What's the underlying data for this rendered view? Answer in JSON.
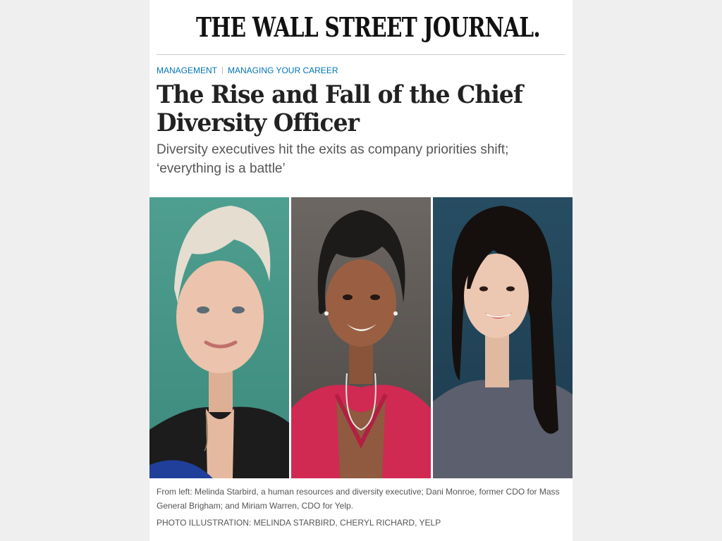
{
  "masthead": {
    "title": "THE WALL STREET JOURNAL."
  },
  "breadcrumb": {
    "section": "MANAGEMENT",
    "subsection": "MANAGING YOUR CAREER"
  },
  "article": {
    "headline": "The Rise and Fall of the Chief Diversity Officer",
    "dek": "Diversity executives hit the exits as company priorities shift; ‘everything is a battle’",
    "caption": "From left: Melinda Starbird, a human resources and diversity executive; Dani Monroe, former CDO for Mass General Brigham; and Miriam Warren, CDO for Yelp.",
    "credit": "PHOTO ILLUSTRATION: MELINDA STARBIRD, CHERYL RICHARD, YELP"
  },
  "colors": {
    "link": "#0274b6",
    "headline": "#222222",
    "body_text": "#555555",
    "page_background": "#efefef"
  }
}
